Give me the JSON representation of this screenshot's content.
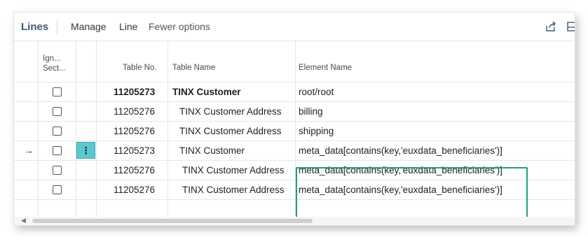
{
  "toolbar": {
    "title": "Lines",
    "actions": [
      "Manage",
      "Line",
      "Fewer options"
    ],
    "icons": [
      "share-icon",
      "panel-icon"
    ]
  },
  "columns": {
    "ignore_section": "Ign... Sect...",
    "ignore_line1": "Ign...",
    "ignore_line2": "Sect...",
    "table_no": "Table No.",
    "table_name": "Table Name",
    "element_name": "Element Name"
  },
  "rows": [
    {
      "table_no": "11205273",
      "table_name": "TINX Customer",
      "element_name": "root/root",
      "bold": true,
      "indent": 0,
      "current": false,
      "checked": false
    },
    {
      "table_no": "11205276",
      "table_name": "TINX Customer Address",
      "element_name": "billing",
      "bold": false,
      "indent": 1,
      "current": false,
      "checked": false
    },
    {
      "table_no": "11205276",
      "table_name": "TINX Customer Address",
      "element_name": "shipping",
      "bold": false,
      "indent": 1,
      "current": false,
      "checked": false
    },
    {
      "table_no": "11205273",
      "table_name": "TINX Customer",
      "element_name": "meta_data[contains(key,'euxdata_beneficiaries')]",
      "bold": false,
      "indent": 2,
      "current": true,
      "checked": false
    },
    {
      "table_no": "11205276",
      "table_name": "TINX Customer Address",
      "element_name": "meta_data[contains(key,'euxdata_beneficiaries')]",
      "bold": false,
      "indent": 3,
      "current": false,
      "checked": false
    },
    {
      "table_no": "11205276",
      "table_name": "TINX Customer Address",
      "element_name": "meta_data[contains(key,'euxdata_beneficiaries')]",
      "bold": false,
      "indent": 3,
      "current": false,
      "checked": false
    }
  ],
  "row_actions_icon": "ellipsis-vertical-icon",
  "current_row_icon": "arrow-right-icon",
  "colors": {
    "title": "#405773",
    "highlight_border": "#1f9e83",
    "row_action_bg": "#5cc9d0"
  }
}
